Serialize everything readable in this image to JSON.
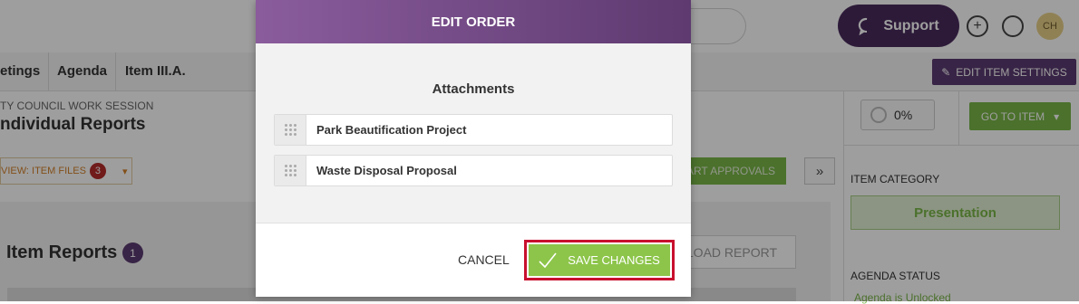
{
  "header": {
    "support_label": "Support",
    "avatar_initials": "CH"
  },
  "breadcrumbs": [
    "etings",
    "Agenda",
    "Item III.A."
  ],
  "edit_item_settings_label": "EDIT ITEM SETTINGS",
  "meeting": {
    "subtitle": "TY COUNCIL WORK SESSION",
    "title": "ndividual Reports"
  },
  "progress": {
    "label": "0%",
    "value": 0
  },
  "goto_item_label": "GO TO ITEM",
  "view_item_files": {
    "label": "VIEW: ITEM FILES",
    "count": "3"
  },
  "approvals_label": "ART APPROVALS",
  "expand_label": "»",
  "sidebar": {
    "item_category_label": "ITEM CATEGORY",
    "item_category_value": "Presentation",
    "agenda_status_label": "AGENDA STATUS",
    "agenda_status_value": "Agenda is Unlocked"
  },
  "reports": {
    "title": "Item Reports",
    "count": "1",
    "upload_label": "PLOAD REPORT"
  },
  "modal": {
    "title": "EDIT ORDER",
    "section_title": "Attachments",
    "attachments": [
      "Park Beautification Project",
      "Waste Disposal Proposal"
    ],
    "cancel_label": "CANCEL",
    "save_label": "SAVE CHANGES"
  },
  "colors": {
    "brand_purple": "#5b3a71",
    "accent_green": "#7ab648",
    "highlight_red": "#c8102e"
  }
}
